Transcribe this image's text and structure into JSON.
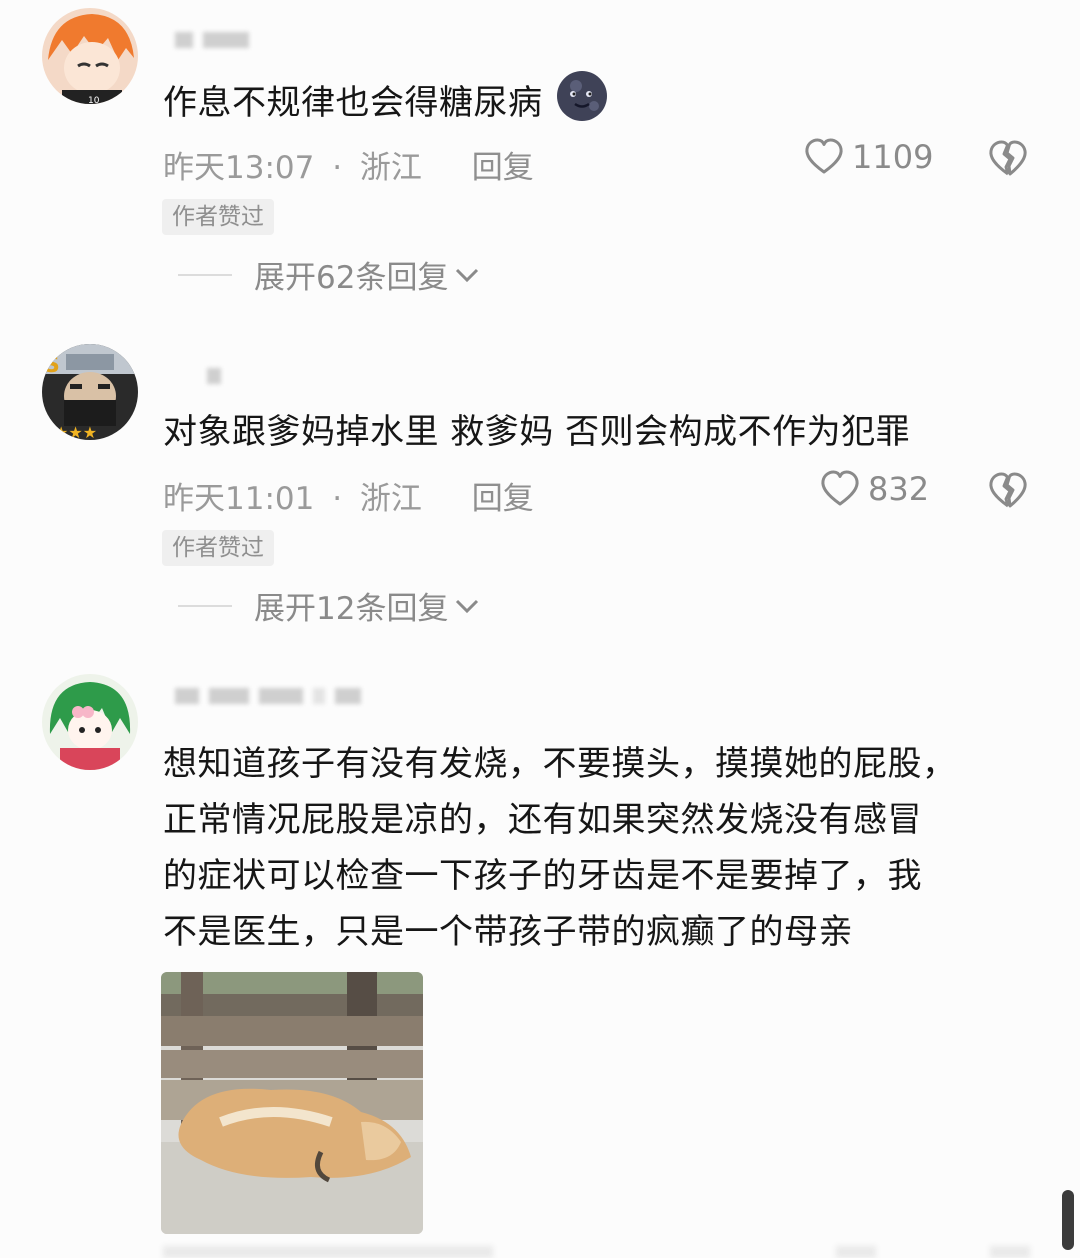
{
  "comments": [
    {
      "text": "作息不规律也会得糖尿病",
      "time": "昨天13:07",
      "location": "浙江",
      "reply_label": "回复",
      "likes": "1109",
      "badge": "作者赞过",
      "expand_label": "展开62条回复"
    },
    {
      "text": "对象跟爹妈掉水里 救爹妈 否则会构成不作为犯罪",
      "time": "昨天11:01",
      "location": "浙江",
      "reply_label": "回复",
      "likes": "832",
      "badge": "作者赞过",
      "expand_label": "展开12条回复"
    },
    {
      "text_lines": [
        "想知道孩子有没有发烧，不要摸头，摸摸她的屁股，",
        "正常情况屁股是凉的，还有如果突然发烧没有感冒",
        "的症状可以检查一下孩子的牙齿是不是要掉了，我",
        "不是医生，只是一个带孩子带的疯癫了的母亲"
      ]
    }
  ],
  "meta_separator": "·",
  "icons": {
    "like": "heart-outline-icon",
    "dislike": "broken-heart-icon",
    "emoji": "new-moon-face-emoji",
    "expand": "chevron-down-icon"
  },
  "colors": {
    "background": "#fcfcfc",
    "text_primary": "#161616",
    "text_secondary": "#9a9a9a",
    "badge_bg": "#efefef"
  }
}
